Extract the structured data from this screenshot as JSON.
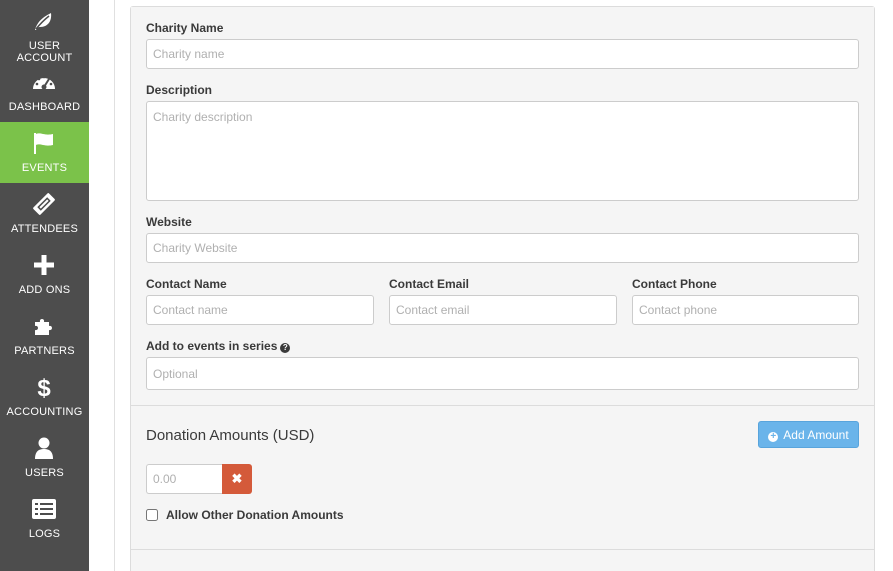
{
  "sidebar": {
    "items": [
      {
        "label": "USER ACCOUNT",
        "icon": "leaf-icon",
        "active": false
      },
      {
        "label": "DASHBOARD",
        "icon": "dashboard-icon",
        "active": false
      },
      {
        "label": "EVENTS",
        "icon": "flag-icon",
        "active": true
      },
      {
        "label": "ATTENDEES",
        "icon": "ticket-icon",
        "active": false
      },
      {
        "label": "ADD ONS",
        "icon": "plus-icon",
        "active": false
      },
      {
        "label": "PARTNERS",
        "icon": "puzzle-icon",
        "active": false
      },
      {
        "label": "ACCOUNTING",
        "icon": "dollar-icon",
        "active": false
      },
      {
        "label": "USERS",
        "icon": "user-icon",
        "active": false
      },
      {
        "label": "LOGS",
        "icon": "list-icon",
        "active": false
      }
    ]
  },
  "form": {
    "charity_name": {
      "label": "Charity Name",
      "placeholder": "Charity name",
      "value": ""
    },
    "description": {
      "label": "Description",
      "placeholder": "Charity description",
      "value": ""
    },
    "website": {
      "label": "Website",
      "placeholder": "Charity Website",
      "value": ""
    },
    "contact_name": {
      "label": "Contact Name",
      "placeholder": "Contact name",
      "value": ""
    },
    "contact_email": {
      "label": "Contact Email",
      "placeholder": "Contact email",
      "value": ""
    },
    "contact_phone": {
      "label": "Contact Phone",
      "placeholder": "Contact phone",
      "value": ""
    },
    "series": {
      "label": "Add to events in series",
      "placeholder": "Optional",
      "value": "",
      "help_icon": "question-circle-icon"
    }
  },
  "donations": {
    "title": "Donation Amounts (USD)",
    "add_button_label": "Add Amount",
    "amount_placeholder": "0.00",
    "remove_glyph": "✖",
    "allow_other_label": "Allow Other Donation Amounts",
    "allow_other_checked": false
  },
  "colors": {
    "sidebar_bg": "#4d4d4d",
    "sidebar_active": "#7bc24a",
    "add_button": "#6ab4ea",
    "remove_button": "#d45a3a"
  }
}
